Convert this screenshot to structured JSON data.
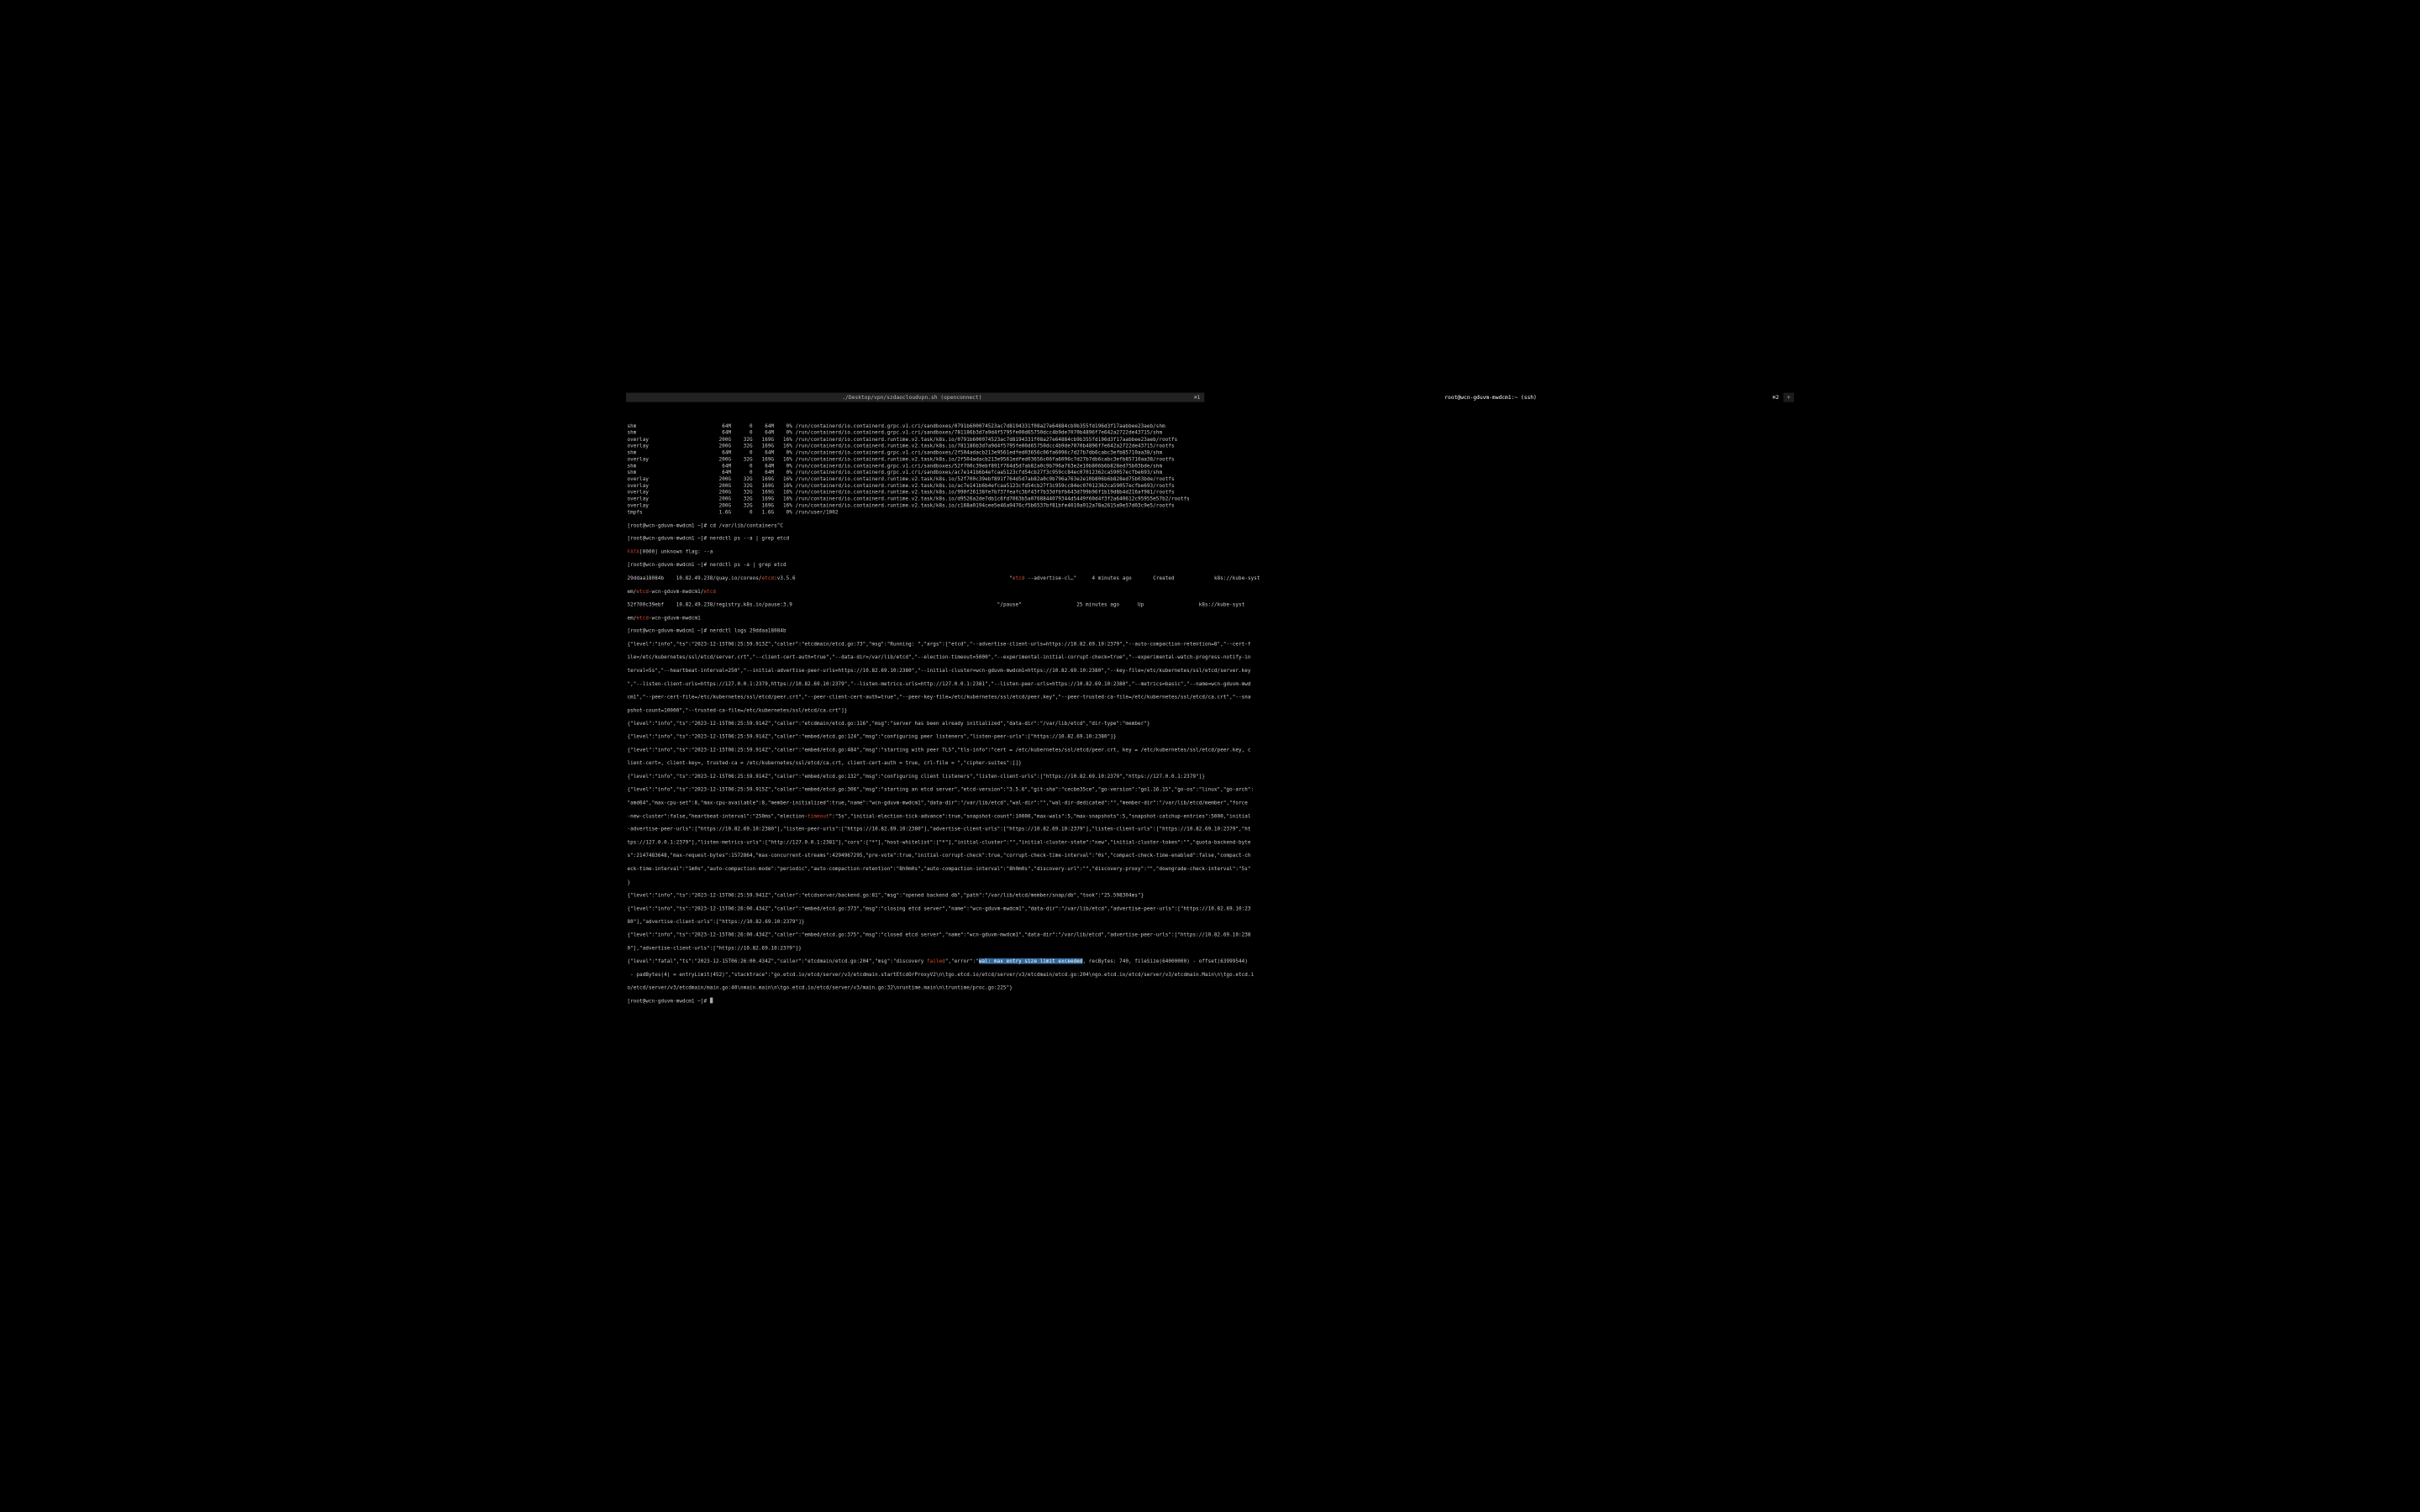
{
  "tabs": {
    "left": {
      "title": "./Desktop/vpn/szdaocloudvpn.sh (openconnect)",
      "hotkey": "⌘1"
    },
    "right": {
      "title": "root@wcn-gduvm-mwdcm1:~ (ssh)",
      "hotkey": "⌘2"
    },
    "add": "+"
  },
  "df_rows": [
    {
      "fs": "shm",
      "size": "64M",
      "used": "0",
      "avail": "64M",
      "pct": "0%",
      "mount": "/run/containerd/io.containerd.grpc.v1.cri/sandboxes/0791b600074523ac7d8194331f08a27e64884cb9b355fd196d3f17aabbee23aeb/shm"
    },
    {
      "fs": "shm",
      "size": "64M",
      "used": "0",
      "avail": "64M",
      "pct": "0%",
      "mount": "/run/containerd/io.containerd.grpc.v1.cri/sandboxes/781186b3d7a9d4f5795fe00d65750dcc4b9de7070b4896f7e642a2722de43715/shm"
    },
    {
      "fs": "overlay",
      "size": "200G",
      "used": "32G",
      "avail": "169G",
      "pct": "16%",
      "mount": "/run/containerd/io.containerd.runtime.v2.task/k8s.io/0791b600074523ac7d8194331f08a27e64884cb9b355fd196d3f17aabbee23aeb/rootfs"
    },
    {
      "fs": "overlay",
      "size": "200G",
      "used": "32G",
      "avail": "169G",
      "pct": "16%",
      "mount": "/run/containerd/io.containerd.runtime.v2.task/k8s.io/781186b3d7a9d4f5795fe00d65750dcc4b9de7070b4896f7e642a2722de43715/rootfs"
    },
    {
      "fs": "shm",
      "size": "64M",
      "used": "0",
      "avail": "64M",
      "pct": "0%",
      "mount": "/run/containerd/io.containerd.grpc.v1.cri/sandboxes/2f504adacb213e9561edfed03656c06fa6096c7d27b7db6cabc3efb85710aa38/shm"
    },
    {
      "fs": "overlay",
      "size": "200G",
      "used": "32G",
      "avail": "169G",
      "pct": "16%",
      "mount": "/run/containerd/io.containerd.runtime.v2.task/k8s.io/2f504adacb213e9561edfed03656c06fa6096c7d27b7db6cabc3efb85710aa38/rootfs"
    },
    {
      "fs": "shm",
      "size": "64M",
      "used": "0",
      "avail": "64M",
      "pct": "0%",
      "mount": "/run/containerd/io.containerd.grpc.v1.cri/sandboxes/52f700c39ebf891f764d5d7ab82a0c9b796a763e2e10b806b6b828ed75b03bde/shm"
    },
    {
      "fs": "shm",
      "size": "64M",
      "used": "0",
      "avail": "64M",
      "pct": "0%",
      "mount": "/run/containerd/io.containerd.grpc.v1.cri/sandboxes/ac7e141b6b4efcaa5123cfd54cb27f3c959cc84ec07012362ca59057ecfbe693/shm"
    },
    {
      "fs": "overlay",
      "size": "200G",
      "used": "32G",
      "avail": "169G",
      "pct": "16%",
      "mount": "/run/containerd/io.containerd.runtime.v2.task/k8s.io/52f700c39ebf891f764d5d7ab82a0c9b796a763e2e10b806b6b828ed75b03bde/rootfs"
    },
    {
      "fs": "overlay",
      "size": "200G",
      "used": "32G",
      "avail": "169G",
      "pct": "16%",
      "mount": "/run/containerd/io.containerd.runtime.v2.task/k8s.io/ac7e141b6b4efcaa5123cfd54cb27f3c959cc84ec07012362ca59057ecfbe693/rootfs"
    },
    {
      "fs": "overlay",
      "size": "200G",
      "used": "32G",
      "avail": "169G",
      "pct": "16%",
      "mount": "/run/containerd/io.containerd.runtime.v2.task/k8s.io/990f26138fe7b737feafc3bf43f7b33dfbfb643d799b96f1b19d8b4d216af981/rootfs"
    },
    {
      "fs": "overlay",
      "size": "200G",
      "used": "32G",
      "avail": "169G",
      "pct": "16%",
      "mount": "/run/containerd/io.containerd.runtime.v2.task/k8s.io/d9526a2de7db1c6fd7063b5a0768844079344d5449f60d4f3f2a640612c95955e57b2/rootfs"
    },
    {
      "fs": "overlay",
      "size": "200G",
      "used": "32G",
      "avail": "169G",
      "pct": "16%",
      "mount": "/run/containerd/io.containerd.runtime.v2.task/k8s.io/c168a0194cee5e46a9476cf5b6537bf81bfe4010a912a78a2615a9e57d03c9e5/rootfs"
    },
    {
      "fs": "tmpfs",
      "size": "1.6G",
      "used": "0",
      "avail": "1.6G",
      "pct": "0%",
      "mount": "/run/user/1002"
    }
  ],
  "cmds": {
    "cd": "cd /var/lib/containers^C",
    "ps_a_a": "nerdctl ps --a | grep etcd",
    "fata_pre": "FATA",
    "fata_post": "[0000] unknown flag: --a",
    "ps_a": "nerdctl ps -a | grep etcd",
    "logs": "nerdctl logs 29ddaa18084b"
  },
  "ps_rows": {
    "r1_id": "29ddaa18084b",
    "r1_img_pre": "10.82.49.238/quay.io/coreos/",
    "r1_img_hi": "etcd",
    "r1_img_post": ":v3.5.6",
    "r1_cmd_q": "\"",
    "r1_cmd_hi": "etcd",
    "r1_cmd_post": " --advertise-cl…\"",
    "r1_age": "4 minutes ago",
    "r1_state": "Created",
    "r1_ns": "k8s://kube-syst",
    "r1_cont_pre": "em/",
    "r1_cont_hi1": "etcd",
    "r1_cont_mid": "-wcn-gduvm-mwdcm1/",
    "r1_cont_hi2": "etcd",
    "r2_id": "52f700c39ebf",
    "r2_img": "10.82.49.238/registry.k8s.io/pause:3.9",
    "r2_cmd": "\"/pause\"",
    "r2_age": "25 minutes ago",
    "r2_state": "Up",
    "r2_ns": "k8s://kube-syst",
    "r2_cont_pre": "em/",
    "r2_cont_hi": "etcd",
    "r2_cont_post": "-wcn-gduvm-mwdcm1"
  },
  "prompt": "[root@wcn-gduvm-mwdcm1 ~]# ",
  "logs": {
    "l1": "{\"level\":\"info\",\"ts\":\"2023-12-15T06:25:59.913Z\",\"caller\":\"etcdmain/etcd.go:73\",\"msg\":\"Running: \",\"args\":[\"etcd\",\"--advertise-client-urls=https://10.82.69.10:2379\",\"--auto-compaction-retention=8\",\"--cert-f",
    "l2": "ile=/etc/kubernetes/ssl/etcd/server.crt\",\"--client-cert-auth=true\",\"--data-dir=/var/lib/etcd\",\"--election-timeout=5000\",\"--experimental-initial-corrupt-check=true\",\"--experimental-watch-progress-notify-in",
    "l3": "terval=5s\",\"--heartbeat-interval=250\",\"--initial-advertise-peer-urls=https://10.82.69.10:2380\",\"--initial-cluster=wcn-gduvm-mwdcm1=https://10.82.69.10:2380\",\"--key-file=/etc/kubernetes/ssl/etcd/server.key",
    "l4": "\",\"--listen-client-urls=https://127.0.0.1:2379,https://10.82.69.10:2379\",\"--listen-metrics-urls=http://127.0.0.1:2381\",\"--listen-peer-urls=https://10.82.69.10:2380\",\"--metrics=basic\",\"--name=wcn-gduvm-mwd",
    "l5": "cm1\",\"--peer-cert-file=/etc/kubernetes/ssl/etcd/peer.crt\",\"--peer-client-cert-auth=true\",\"--peer-key-file=/etc/kubernetes/ssl/etcd/peer.key\",\"--peer-trusted-ca-file=/etc/kubernetes/ssl/etcd/ca.crt\",\"--sna",
    "l6": "pshot-count=10000\",\"--trusted-ca-file=/etc/kubernetes/ssl/etcd/ca.crt\"]}",
    "l7": "{\"level\":\"info\",\"ts\":\"2023-12-15T06:25:59.914Z\",\"caller\":\"etcdmain/etcd.go:116\",\"msg\":\"server has been already initialized\",\"data-dir\":\"/var/lib/etcd\",\"dir-type\":\"member\"}",
    "l8": "{\"level\":\"info\",\"ts\":\"2023-12-15T06:25:59.914Z\",\"caller\":\"embed/etcd.go:124\",\"msg\":\"configuring peer listeners\",\"listen-peer-urls\":[\"https://10.82.69.10:2380\"]}",
    "l9": "{\"level\":\"info\",\"ts\":\"2023-12-15T06:25:59.914Z\",\"caller\":\"embed/etcd.go:484\",\"msg\":\"starting with peer TLS\",\"tls-info\":\"cert = /etc/kubernetes/ssl/etcd/peer.crt, key = /etc/kubernetes/ssl/etcd/peer.key, c",
    "l10": "lient-cert=, client-key=, trusted-ca = /etc/kubernetes/ssl/etcd/ca.crt, client-cert-auth = true, crl-file = \",\"cipher-suites\":[]}",
    "l11": "{\"level\":\"info\",\"ts\":\"2023-12-15T06:25:59.914Z\",\"caller\":\"embed/etcd.go:132\",\"msg\":\"configuring client listeners\",\"listen-client-urls\":[\"https://10.82.69.10:2379\",\"https://127.0.0.1:2379\"]}",
    "l12a": "{\"level\":\"info\",\"ts\":\"2023-12-15T06:25:59.915Z\",\"caller\":\"embed/etcd.go:306\",\"msg\":\"starting an etcd server\",\"etcd-version\":\"3.5.6\",\"git-sha\":\"cecbe35ce\",\"go-version\":\"go1.16.15\",\"go-os\":\"linux\",\"go-arch\":",
    "l12b": "\"amd64\",\"max-cpu-set\":8,\"max-cpu-available\":8,\"member-initialized\":true,\"name\":\"wcn-gduvm-mwdcm1\",\"data-dir\":\"/var/lib/etcd\",\"wal-dir\":\"\",\"wal-dir-dedicated\":\"\",\"member-dir\":\"/var/lib/etcd/member\",\"force",
    "l12c_pre": "-new-cluster\":false,\"heartbeat-interval\":\"250ms\",\"election-",
    "l12c_hi": "timeout",
    "l12c_post": "\":\"5s\",\"initial-election-tick-advance\":true,\"snapshot-count\":10000,\"max-wals\":5,\"max-snapshots\":5,\"snapshot-catchup-entries\":5000,\"initial",
    "l12d": "-advertise-peer-urls\":[\"https://10.82.69.10:2380\"],\"listen-peer-urls\":[\"https://10.82.69.10:2380\"],\"advertise-client-urls\":[\"https://10.82.69.10:2379\"],\"listen-client-urls\":[\"https://10.82.69.10:2379\",\"ht",
    "l12e": "tps://127.0.0.1:2379\"],\"listen-metrics-urls\":[\"http://127.0.0.1:2381\"],\"cors\":[\"*\"],\"host-whitelist\":[\"*\"],\"initial-cluster\":\"\",\"initial-cluster-state\":\"new\",\"initial-cluster-token\":\"\",\"quota-backend-byte",
    "l12f": "s\":2147483648,\"max-request-bytes\":1572864,\"max-concurrent-streams\":4294967295,\"pre-vote\":true,\"initial-corrupt-check\":true,\"corrupt-check-time-interval\":\"0s\",\"compact-check-time-enabled\":false,\"compact-ch",
    "l12g": "eck-time-interval\":\"1m0s\",\"auto-compaction-mode\":\"periodic\",\"auto-compaction-retention\":\"8h0m0s\",\"auto-compaction-interval\":\"8h0m0s\",\"discovery-url\":\"\",\"discovery-proxy\":\"\",\"downgrade-check-interval\":\"5s\"",
    "l12h": "}",
    "l13": "{\"level\":\"info\",\"ts\":\"2023-12-15T06:25:59.941Z\",\"caller\":\"etcdserver/backend.go:81\",\"msg\":\"opened backend db\",\"path\":\"/var/lib/etcd/member/snap/db\",\"took\":\"25.598304ms\"}",
    "l14a": "{\"level\":\"info\",\"ts\":\"2023-12-15T06:26:00.434Z\",\"caller\":\"embed/etcd.go:373\",\"msg\":\"closing etcd server\",\"name\":\"wcn-gduvm-mwdcm1\",\"data-dir\":\"/var/lib/etcd\",\"advertise-peer-urls\":[\"https://10.82.69.10:23",
    "l14b": "80\"],\"advertise-client-urls\":[\"https://10.82.69.10:2379\"]}",
    "l15a": "{\"level\":\"info\",\"ts\":\"2023-12-15T06:26:00.434Z\",\"caller\":\"embed/etcd.go:375\",\"msg\":\"closed etcd server\",\"name\":\"wcn-gduvm-mwdcm1\",\"data-dir\":\"/var/lib/etcd\",\"advertise-peer-urls\":[\"https://10.82.69.10:238",
    "l15b": "0\"],\"advertise-client-urls\":[\"https://10.82.69.10:2379\"]}",
    "l16_pre": "{\"level\":\"fatal\",\"ts\":\"2023-12-15T06:26:00.434Z\",\"caller\":\"etcdmain/etcd.go:204\",\"msg\":\"discovery ",
    "l16_hi": "failed",
    "l16_mid": "\",\"error\":\"",
    "l16_sel": "wal: max entry size limit exceeded",
    "l16_post": ", recBytes: 740, fileSize(64000000) - offset(63999544)",
    "l17": " - padBytes(4) = entryLimit(452)\",\"stacktrace\":\"go.etcd.io/etcd/server/v3/etcdmain.startEtcdOrProxyV2\\n\\tgo.etcd.io/etcd/server/v3/etcdmain/etcd.go:204\\ngo.etcd.io/etcd/server/v3/etcdmain.Main\\n\\tgo.etcd.i",
    "l18": "o/etcd/server/v3/etcdmain/main.go:40\\nmain.main\\n\\tgo.etcd.io/etcd/server/v3/main.go:32\\nruntime.main\\n\\truntime/proc.go:225\"}"
  }
}
